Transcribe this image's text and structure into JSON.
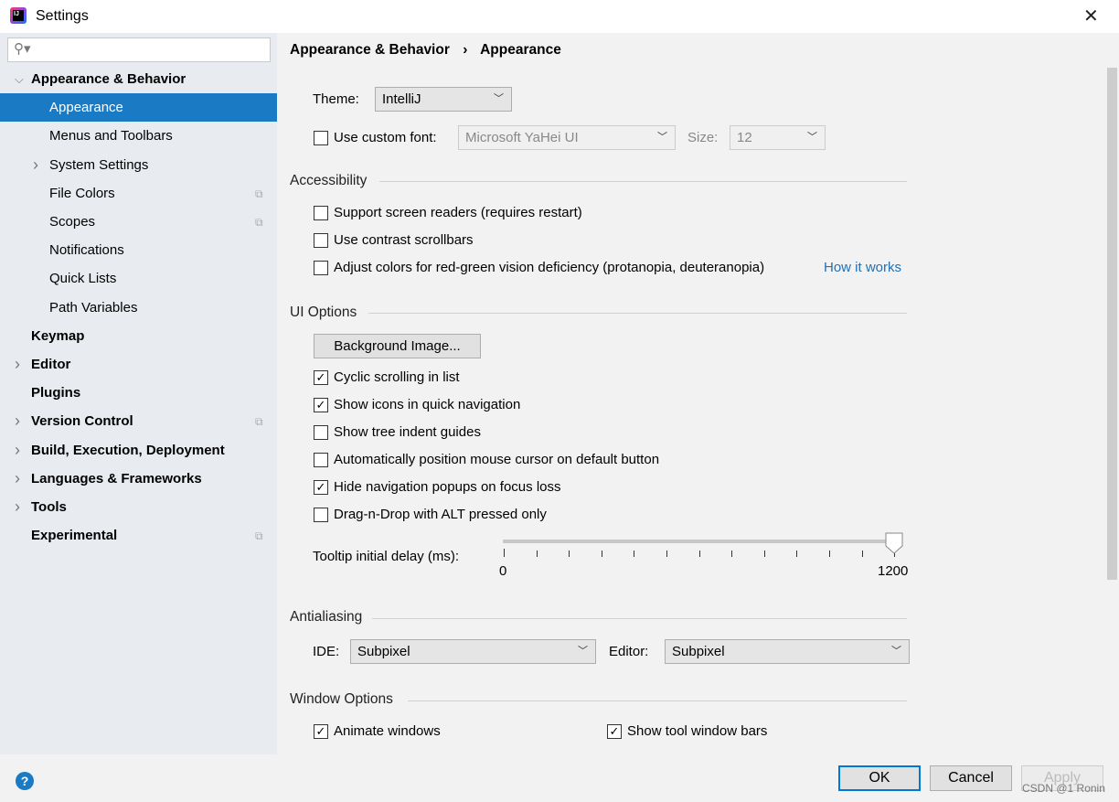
{
  "window": {
    "title": "Settings"
  },
  "search": {
    "icon": "search-icon",
    "value": ""
  },
  "sidebar": {
    "items": [
      {
        "label": "Appearance & Behavior",
        "level": 0,
        "bold": true,
        "expanded": true
      },
      {
        "label": "Appearance",
        "level": 1,
        "selected": true
      },
      {
        "label": "Menus and Toolbars",
        "level": 1
      },
      {
        "label": "System Settings",
        "level": 1,
        "collapsible": true
      },
      {
        "label": "File Colors",
        "level": 1,
        "project": true
      },
      {
        "label": "Scopes",
        "level": 1,
        "project": true
      },
      {
        "label": "Notifications",
        "level": 1
      },
      {
        "label": "Quick Lists",
        "level": 1
      },
      {
        "label": "Path Variables",
        "level": 1
      },
      {
        "label": "Keymap",
        "level": 0,
        "bold": true
      },
      {
        "label": "Editor",
        "level": 0,
        "bold": true,
        "collapsible": true
      },
      {
        "label": "Plugins",
        "level": 0,
        "bold": true
      },
      {
        "label": "Version Control",
        "level": 0,
        "bold": true,
        "collapsible": true,
        "project": true
      },
      {
        "label": "Build, Execution, Deployment",
        "level": 0,
        "bold": true,
        "collapsible": true
      },
      {
        "label": "Languages & Frameworks",
        "level": 0,
        "bold": true,
        "collapsible": true
      },
      {
        "label": "Tools",
        "level": 0,
        "bold": true,
        "collapsible": true
      },
      {
        "label": "Experimental",
        "level": 0,
        "bold": true,
        "project": true
      }
    ]
  },
  "breadcrumb": {
    "parent": "Appearance & Behavior",
    "sep": "›",
    "current": "Appearance"
  },
  "theme": {
    "label": "Theme:",
    "value": "IntelliJ"
  },
  "custom_font": {
    "label": "Use custom font:",
    "checked": false,
    "font": "Microsoft YaHei UI",
    "size_label": "Size:",
    "size": "12"
  },
  "accessibility": {
    "title": "Accessibility",
    "options": [
      {
        "label": "Support screen readers (requires restart)",
        "checked": false
      },
      {
        "label": "Use contrast scrollbars",
        "checked": false
      },
      {
        "label": "Adjust colors for red-green vision deficiency (protanopia, deuteranopia)",
        "checked": false
      }
    ],
    "link": "How it works"
  },
  "ui_options": {
    "title": "UI Options",
    "bg_button": "Background Image...",
    "options": [
      {
        "label": "Cyclic scrolling in list",
        "checked": true
      },
      {
        "label": "Show icons in quick navigation",
        "checked": true
      },
      {
        "label": "Show tree indent guides",
        "checked": false
      },
      {
        "label": "Automatically position mouse cursor on default button",
        "checked": false
      },
      {
        "label": "Hide navigation popups on focus loss",
        "checked": true
      },
      {
        "label": "Drag-n-Drop with ALT pressed only",
        "checked": false
      }
    ],
    "tooltip": {
      "label": "Tooltip initial delay (ms):",
      "min": "0",
      "max": "1200",
      "value": 1200
    }
  },
  "antialiasing": {
    "title": "Antialiasing",
    "ide_label": "IDE:",
    "ide": "Subpixel",
    "editor_label": "Editor:",
    "editor": "Subpixel"
  },
  "window_options": {
    "title": "Window Options",
    "options": [
      {
        "label": "Animate windows",
        "checked": true
      },
      {
        "label": "Show tool window bars",
        "checked": true
      }
    ]
  },
  "footer": {
    "help": "?",
    "ok": "OK",
    "cancel": "Cancel",
    "apply": "Apply",
    "watermark": "CSDN @1 Ronin"
  }
}
